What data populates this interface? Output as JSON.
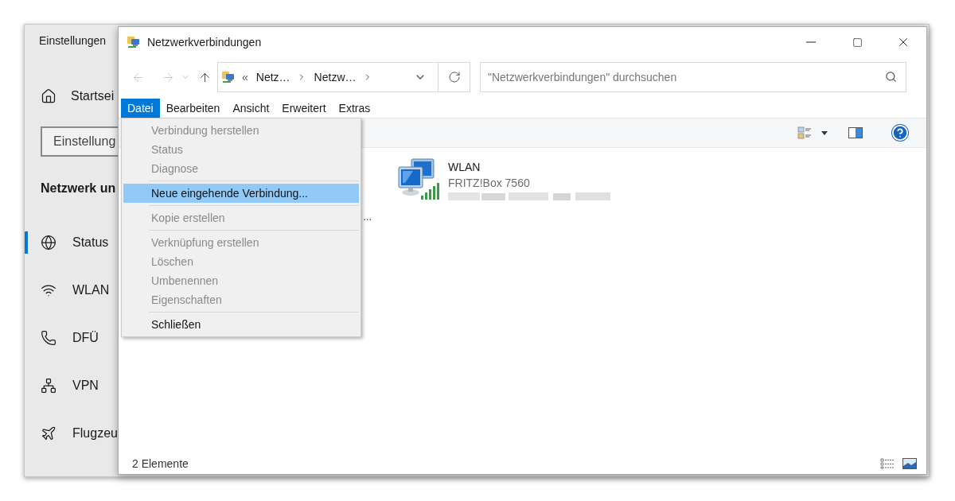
{
  "settings": {
    "title": "Einstellungen",
    "home": {
      "label": "Startsei"
    },
    "search": {
      "value": "Einstellung"
    },
    "section": "Netzwerk un",
    "nav": [
      {
        "label": "Status",
        "kind": "globe",
        "selected": true
      },
      {
        "label": "WLAN",
        "kind": "wifi",
        "selected": false
      },
      {
        "label": "DFÜ",
        "kind": "phone",
        "selected": false
      },
      {
        "label": "VPN",
        "kind": "vpn",
        "selected": false
      },
      {
        "label": "Flugzeu",
        "kind": "plane",
        "selected": false
      }
    ]
  },
  "explorer": {
    "title": "Netzwerkverbindungen",
    "address": {
      "overflow": "«",
      "crumbs": [
        "Netz…",
        "Netzw…"
      ]
    },
    "search": {
      "placeholder": "\"Netzwerkverbindungen\" durchsuchen"
    },
    "menubar": [
      {
        "label": "Datei",
        "selected": true
      },
      {
        "label": "Bearbeiten",
        "selected": false
      },
      {
        "label": "Ansicht",
        "selected": false
      },
      {
        "label": "Erweitert",
        "selected": false
      },
      {
        "label": "Extras",
        "selected": false
      }
    ],
    "menu": [
      {
        "kind": "item",
        "label": "Verbindung herstellen",
        "disabled": true,
        "selected": false
      },
      {
        "kind": "item",
        "label": "Status",
        "disabled": true,
        "selected": false
      },
      {
        "kind": "item",
        "label": "Diagnose",
        "disabled": true,
        "selected": false
      },
      {
        "kind": "separator"
      },
      {
        "kind": "item",
        "label": "Neue eingehende Verbindung...",
        "disabled": false,
        "selected": true
      },
      {
        "kind": "separator"
      },
      {
        "kind": "item",
        "label": "Kopie erstellen",
        "disabled": true,
        "selected": false
      },
      {
        "kind": "separator"
      },
      {
        "kind": "item",
        "label": "Verknüpfung erstellen",
        "disabled": true,
        "selected": false
      },
      {
        "kind": "item",
        "label": "Löschen",
        "disabled": true,
        "selected": false
      },
      {
        "kind": "item",
        "label": "Umbenennen",
        "disabled": true,
        "selected": false
      },
      {
        "kind": "item",
        "label": "Eigenschaften",
        "disabled": true,
        "selected": false
      },
      {
        "kind": "separator"
      },
      {
        "kind": "item",
        "label": "Schließen",
        "disabled": false,
        "selected": false
      }
    ],
    "hidden_item": {
      "label": "..."
    },
    "connection": {
      "name": "WLAN",
      "device": "FRITZ!Box 7560"
    },
    "status_bar": "2 Elemente"
  }
}
